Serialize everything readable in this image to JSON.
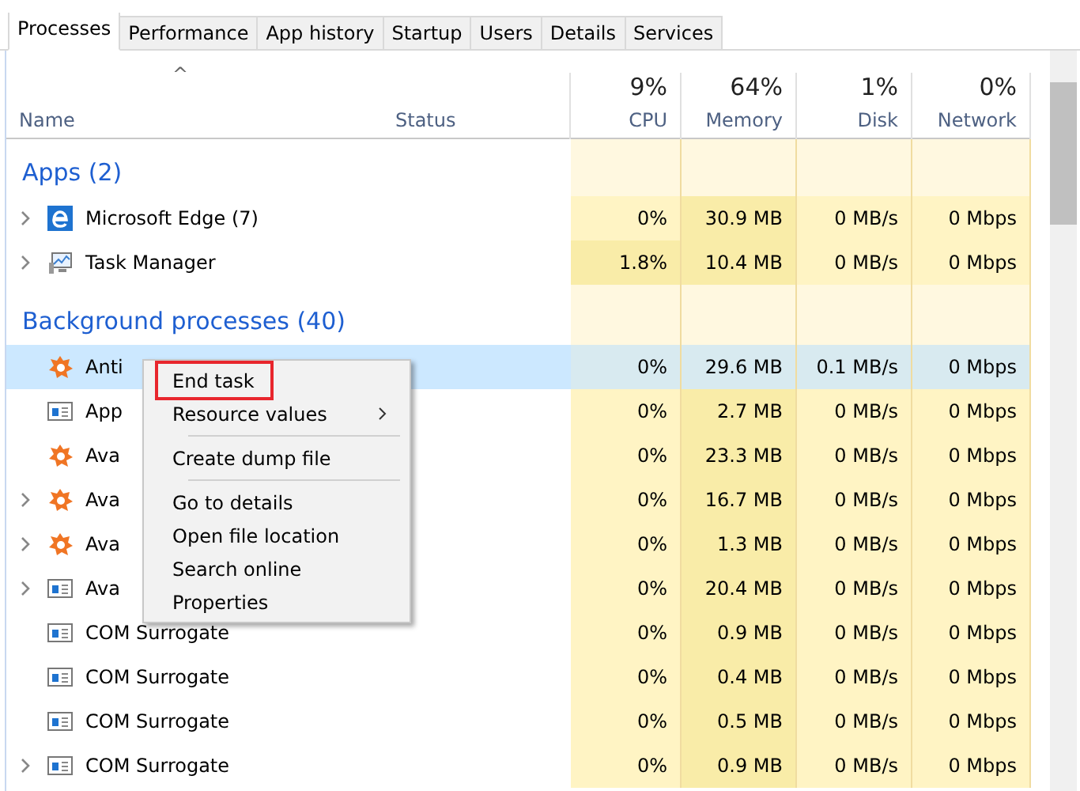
{
  "tabs": [
    {
      "label": "Processes",
      "selected": true
    },
    {
      "label": "Performance",
      "selected": false
    },
    {
      "label": "App history",
      "selected": false
    },
    {
      "label": "Startup",
      "selected": false
    },
    {
      "label": "Users",
      "selected": false
    },
    {
      "label": "Details",
      "selected": false
    },
    {
      "label": "Services",
      "selected": false
    }
  ],
  "sort_arrow": "^",
  "columns": [
    {
      "label": "Name"
    },
    {
      "label": "Status"
    },
    {
      "label": "CPU",
      "total": "9%"
    },
    {
      "label": "Memory",
      "total": "64%"
    },
    {
      "label": "Disk",
      "total": "1%"
    },
    {
      "label": "Network",
      "total": "0%"
    }
  ],
  "rows": [
    {
      "kind": "group",
      "name": "Apps (2)"
    },
    {
      "kind": "browser",
      "expandable": true,
      "selected": false,
      "name": "Microsoft Edge (7)",
      "cpu": "0%",
      "memory": "30.9 MB",
      "disk": "0 MB/s",
      "network": "0 Mbps",
      "cpu_hot": false
    },
    {
      "kind": "monitor",
      "expandable": true,
      "selected": false,
      "name": "Task Manager",
      "cpu": "1.8%",
      "memory": "10.4 MB",
      "disk": "0 MB/s",
      "network": "0 Mbps",
      "cpu_hot": true
    },
    {
      "kind": "group",
      "name": "Background processes (40)"
    },
    {
      "kind": "shield",
      "expandable": false,
      "selected": true,
      "name": "Anti",
      "cpu": "0%",
      "memory": "29.6 MB",
      "disk": "0.1 MB/s",
      "network": "0 Mbps",
      "cpu_hot": false
    },
    {
      "kind": "window",
      "expandable": false,
      "selected": false,
      "name": "App",
      "cpu": "0%",
      "memory": "2.7 MB",
      "disk": "0 MB/s",
      "network": "0 Mbps",
      "cpu_hot": false
    },
    {
      "kind": "shield",
      "expandable": false,
      "selected": false,
      "name": "Ava",
      "cpu": "0%",
      "memory": "23.3 MB",
      "disk": "0 MB/s",
      "network": "0 Mbps",
      "cpu_hot": false
    },
    {
      "kind": "shield",
      "expandable": true,
      "selected": false,
      "name": "Ava",
      "cpu": "0%",
      "memory": "16.7 MB",
      "disk": "0 MB/s",
      "network": "0 Mbps",
      "cpu_hot": false
    },
    {
      "kind": "shield",
      "expandable": true,
      "selected": false,
      "name": "Ava",
      "cpu": "0%",
      "memory": "1.3 MB",
      "disk": "0 MB/s",
      "network": "0 Mbps",
      "cpu_hot": false
    },
    {
      "kind": "window",
      "expandable": true,
      "selected": false,
      "name": "Ava",
      "cpu": "0%",
      "memory": "20.4 MB",
      "disk": "0 MB/s",
      "network": "0 Mbps",
      "cpu_hot": false
    },
    {
      "kind": "window",
      "expandable": false,
      "selected": false,
      "name": "COM Surrogate",
      "cpu": "0%",
      "memory": "0.9 MB",
      "disk": "0 MB/s",
      "network": "0 Mbps",
      "cpu_hot": false
    },
    {
      "kind": "window",
      "expandable": false,
      "selected": false,
      "name": "COM Surrogate",
      "cpu": "0%",
      "memory": "0.4 MB",
      "disk": "0 MB/s",
      "network": "0 Mbps",
      "cpu_hot": false
    },
    {
      "kind": "window",
      "expandable": false,
      "selected": false,
      "name": "COM Surrogate",
      "cpu": "0%",
      "memory": "0.5 MB",
      "disk": "0 MB/s",
      "network": "0 Mbps",
      "cpu_hot": false
    },
    {
      "kind": "window",
      "expandable": true,
      "selected": false,
      "name": "COM Surrogate",
      "cpu": "0%",
      "memory": "0.9 MB",
      "disk": "0 MB/s",
      "network": "0 Mbps",
      "cpu_hot": false
    }
  ],
  "context_menu": [
    {
      "label": "End task",
      "outlined": true,
      "submenu": false,
      "separator_before": false
    },
    {
      "label": "Resource values",
      "outlined": false,
      "submenu": true,
      "separator_before": false
    },
    {
      "label": "Create dump file",
      "outlined": false,
      "submenu": false,
      "separator_before": true
    },
    {
      "label": "Go to details",
      "outlined": false,
      "submenu": false,
      "separator_before": true
    },
    {
      "label": "Open file location",
      "outlined": false,
      "submenu": false,
      "separator_before": false
    },
    {
      "label": "Search online",
      "outlined": false,
      "submenu": false,
      "separator_before": false
    },
    {
      "label": "Properties",
      "outlined": false,
      "submenu": false,
      "separator_before": false
    }
  ]
}
